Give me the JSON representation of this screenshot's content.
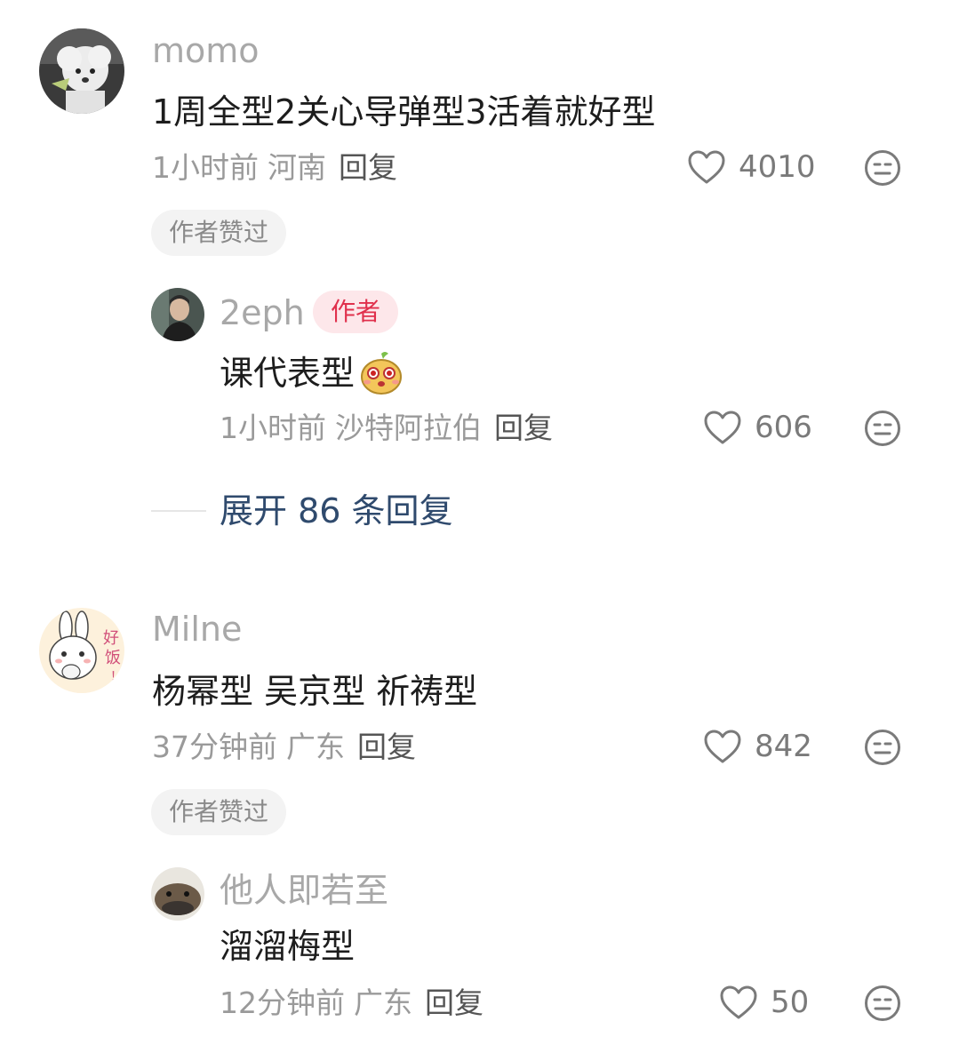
{
  "comments": [
    {
      "username": "momo",
      "text": "1周全型2关心导弹型3活着就好型",
      "time": "1小时前",
      "location": "河南",
      "reply_label": "回复",
      "likes": "4010",
      "badge": "作者赞过",
      "reply": {
        "username": "2eph",
        "author_tag": "作者",
        "text": "课代表型",
        "time": "1小时前",
        "location": "沙特阿拉伯",
        "reply_label": "回复",
        "likes": "606"
      },
      "expand_label": "展开 86 条回复"
    },
    {
      "username": "Milne",
      "text": "杨幂型 吴京型 祈祷型",
      "time": "37分钟前",
      "location": "广东",
      "reply_label": "回复",
      "likes": "842",
      "badge": "作者赞过",
      "avatar_text": "好饭！",
      "reply": {
        "username": "他人即若至",
        "text": "溜溜梅型",
        "time": "12分钟前",
        "location": "广东",
        "reply_label": "回复",
        "likes": "50"
      }
    }
  ],
  "icons": {
    "like": "heart-outline-icon",
    "dislike": "neutral-face-icon",
    "emoji": "mouse-sticker-emoji"
  },
  "colors": {
    "author_tag_text": "#e0304c",
    "author_tag_bg": "#fde7ea",
    "expand_link": "#2f4a6d"
  }
}
